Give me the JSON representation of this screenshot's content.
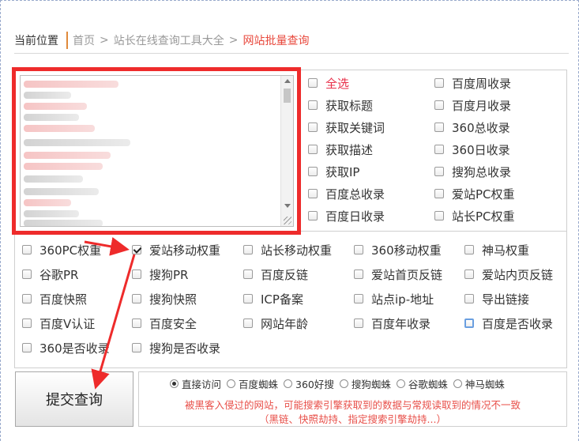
{
  "breadcrumb": {
    "label": "当前位置",
    "home": "首页",
    "sep1": ">",
    "section": "站长在线查询工具大全",
    "sep2": ">",
    "current": "网站批量查询"
  },
  "options_top": {
    "select_all": "全选",
    "get_title": "获取标题",
    "get_keywords": "获取关键词",
    "get_description": "获取描述",
    "get_ip": "获取IP",
    "baidu_total": "百度总收录",
    "baidu_daily": "百度日收录",
    "baidu_weekly": "百度周收录",
    "baidu_monthly": "百度月收录",
    "so360_total": "360总收录",
    "so360_daily": "360日收录",
    "sogou_total": "搜狗总收录",
    "aizhan_pc": "爱站PC权重",
    "zhanzhang_pc": "站长PC权重"
  },
  "options_bottom": {
    "so360_pc": "360PC权重",
    "aizhan_mobile": "爱站移动权重",
    "zhanzhang_mobile": "站长移动权重",
    "so360_mobile": "360移动权重",
    "shenma": "神马权重",
    "google_pr": "谷歌PR",
    "sogou_pr": "搜狗PR",
    "baidu_backlinks": "百度反链",
    "aizhan_home_backlinks": "爱站首页反链",
    "aizhan_inner_backlinks": "爱站内页反链",
    "baidu_snapshot": "百度快照",
    "sogou_snapshot": "搜狗快照",
    "icp": "ICP备案",
    "site_ip": "站点ip-地址",
    "export_links": "导出链接",
    "baidu_v": "百度V认证",
    "baidu_security": "百度安全",
    "site_age": "网站年龄",
    "baidu_yearly": "百度年收录",
    "baidu_indexed": "百度是否收录",
    "so360_indexed": "360是否收录",
    "sogou_indexed": "搜狗是否收录"
  },
  "checked": {
    "aizhan_mobile": true
  },
  "submit": {
    "label": "提交查询"
  },
  "modes": {
    "direct": "直接访问",
    "baidu_spider": "百度蜘蛛",
    "so360": "360好搜",
    "sogou_spider": "搜狗蜘蛛",
    "google_spider": "谷歌蜘蛛",
    "shenma_spider": "神马蜘蛛",
    "selected": "直接访问"
  },
  "notes": {
    "line1": "被黑客入侵过的网站，可能搜索引擎获取到的数据与常规读取到的情况不一致",
    "line2": "（黑链、快照劫持、指定搜索引擎劫持...）"
  },
  "colors": {
    "annotation_red": "#ee2b2b",
    "current_crumb": "#e8483c",
    "note_text": "#e8504a"
  }
}
